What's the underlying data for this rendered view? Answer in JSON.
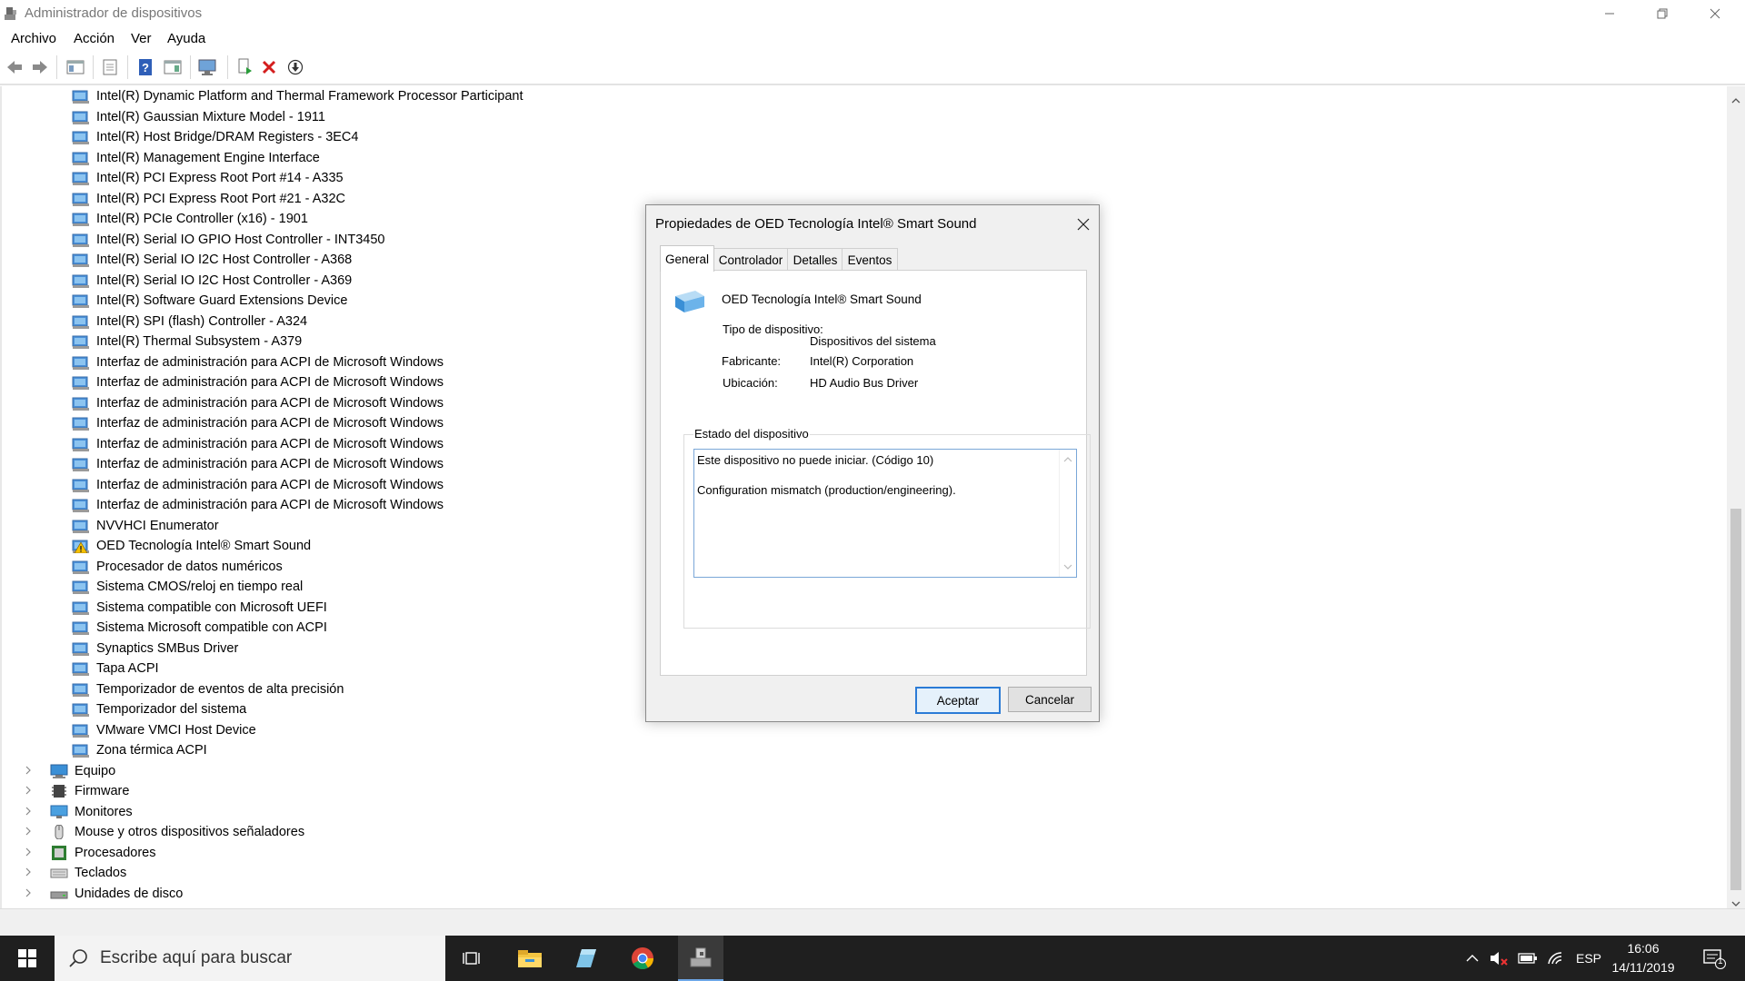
{
  "window": {
    "title": "Administrador de dispositivos"
  },
  "menu": [
    "Archivo",
    "Acción",
    "Ver",
    "Ayuda"
  ],
  "tree": {
    "system_devices": [
      "Intel(R) Dynamic Platform and Thermal Framework Processor Participant",
      "Intel(R) Gaussian Mixture Model - 1911",
      "Intel(R) Host Bridge/DRAM Registers - 3EC4",
      "Intel(R) Management Engine Interface",
      "Intel(R) PCI Express Root Port #14 - A335",
      "Intel(R) PCI Express Root Port #21 - A32C",
      "Intel(R) PCIe Controller (x16) - 1901",
      "Intel(R) Serial IO GPIO Host Controller - INT3450",
      "Intel(R) Serial IO I2C Host Controller - A368",
      "Intel(R) Serial IO I2C Host Controller - A369",
      "Intel(R) Software Guard Extensions Device",
      "Intel(R) SPI (flash) Controller - A324",
      "Intel(R) Thermal Subsystem - A379",
      "Interfaz de administración para ACPI de Microsoft Windows",
      "Interfaz de administración para ACPI de Microsoft Windows",
      "Interfaz de administración para ACPI de Microsoft Windows",
      "Interfaz de administración para ACPI de Microsoft Windows",
      "Interfaz de administración para ACPI de Microsoft Windows",
      "Interfaz de administración para ACPI de Microsoft Windows",
      "Interfaz de administración para ACPI de Microsoft Windows",
      "Interfaz de administración para ACPI de Microsoft Windows",
      "NVVHCI Enumerator",
      "OED Tecnología Intel® Smart Sound",
      "Procesador de datos numéricos",
      "Sistema CMOS/reloj en tiempo real",
      "Sistema compatible con Microsoft UEFI",
      "Sistema Microsoft compatible con ACPI",
      "Synaptics SMBus Driver",
      "Tapa ACPI",
      "Temporizador de eventos de alta precisión",
      "Temporizador del sistema",
      "VMware VMCI Host Device",
      "Zona térmica ACPI"
    ],
    "warning_item": "OED Tecnología Intel® Smart Sound",
    "categories": [
      {
        "label": "Equipo",
        "icon": "computer-icon"
      },
      {
        "label": "Firmware",
        "icon": "firmware-icon"
      },
      {
        "label": "Monitores",
        "icon": "monitor-icon"
      },
      {
        "label": "Mouse y otros dispositivos señaladores",
        "icon": "mouse-icon"
      },
      {
        "label": "Procesadores",
        "icon": "processor-icon"
      },
      {
        "label": "Teclados",
        "icon": "keyboard-icon"
      },
      {
        "label": "Unidades de disco",
        "icon": "disk-icon"
      }
    ]
  },
  "dialog": {
    "title": "Propiedades de OED Tecnología Intel® Smart Sound",
    "tabs": [
      "General",
      "Controlador",
      "Detalles",
      "Eventos"
    ],
    "active_tab": "General",
    "device_name": "OED Tecnología Intel® Smart Sound",
    "type_label": "Tipo de dispositivo:",
    "type_value": "Dispositivos del sistema",
    "manufacturer_label": "Fabricante:",
    "manufacturer_value": "Intel(R) Corporation",
    "location_label": "Ubicación:",
    "location_value": "HD Audio Bus Driver",
    "status_group_title": "Estado del dispositivo",
    "status_line1": "Este dispositivo no puede iniciar. (Código 10)",
    "status_line2": "Configuration mismatch (production/engineering).",
    "ok_label": "Aceptar",
    "cancel_label": "Cancelar"
  },
  "taskbar": {
    "search_placeholder": "Escribe aquí para buscar",
    "language": "ESP",
    "time": "16:06",
    "date": "14/11/2019",
    "notification_count": "1"
  },
  "colors": {
    "accent": "#2b7bd6",
    "taskbar": "#1f1f1f",
    "warning": "#f5c000"
  }
}
